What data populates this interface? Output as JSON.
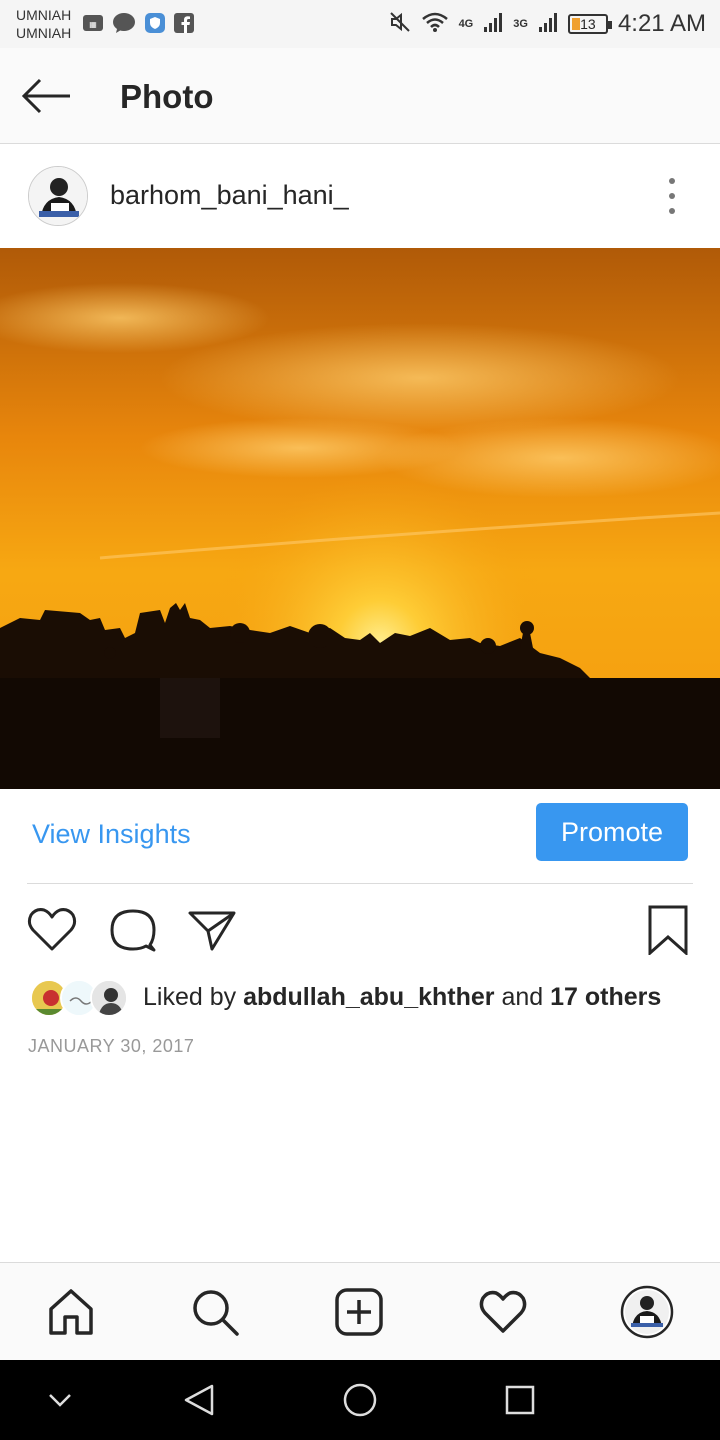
{
  "status_bar": {
    "carrier_1": "UMNIAH",
    "carrier_2": "UMNIAH",
    "network_1": "4G",
    "network_2": "3G",
    "battery": "13",
    "time": "4:21 AM",
    "icons": [
      "messenger-icon",
      "shield-app-icon",
      "facebook-icon",
      "mute-icon",
      "wifi-icon",
      "signal-icon",
      "battery-icon"
    ]
  },
  "header": {
    "title": "Photo",
    "back_icon": "back-arrow-icon"
  },
  "post": {
    "username": "barhom_bani_hani_",
    "more_icon": "more-options-icon",
    "photo_subject": "sunset-over-city-silhouette"
  },
  "insights": {
    "view_insights_label": "View Insights",
    "promote_label": "Promote"
  },
  "actions": [
    "heart-icon",
    "comment-icon",
    "share-icon",
    "bookmark-icon"
  ],
  "likes": {
    "prefix": "Liked by ",
    "liker": "abdullah_abu_khther",
    "middle": " and ",
    "others": "17 others"
  },
  "date": "JANUARY 30, 2017",
  "bottom_nav": [
    "home-icon",
    "search-icon",
    "new-post-icon",
    "activity-icon",
    "profile-icon"
  ],
  "system_nav": [
    "hide-icon",
    "back-icon",
    "home-icon",
    "recents-icon"
  ],
  "colors": {
    "accent": "#3897f0",
    "text": "#262626",
    "muted": "#999999"
  }
}
